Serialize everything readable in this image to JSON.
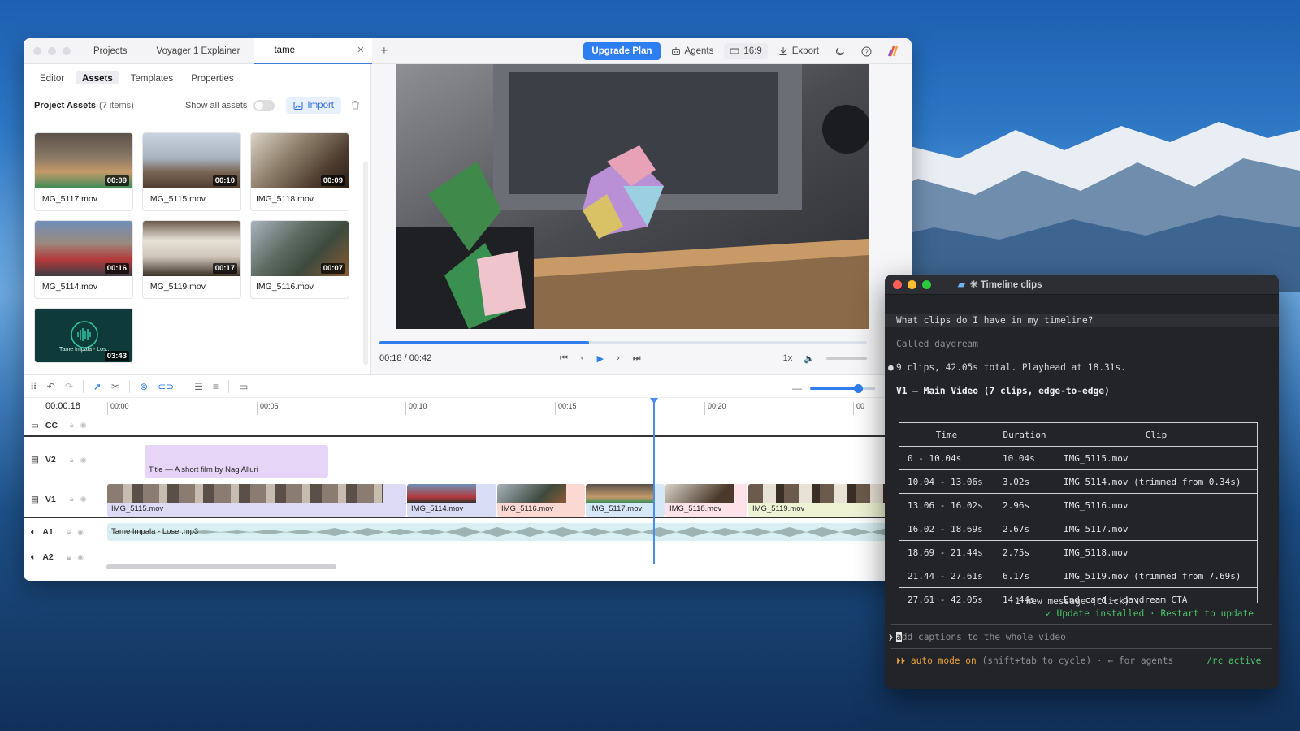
{
  "editor": {
    "tabs": [
      {
        "label": "Projects"
      },
      {
        "label": "Voyager 1 Explainer"
      },
      {
        "label": "tame",
        "active": true
      }
    ],
    "toolbar": {
      "upgrade_label": "Upgrade Plan",
      "agents_label": "Agents",
      "ratio_label": "16:9",
      "export_label": "Export"
    },
    "subtabs": [
      "Editor",
      "Assets",
      "Templates",
      "Properties"
    ],
    "assets": {
      "title": "Project Assets",
      "count": "(7 items)",
      "show_all_label": "Show all assets",
      "import_label": "Import",
      "items": [
        {
          "name": "IMG_5117.mov",
          "duration": "00:09"
        },
        {
          "name": "IMG_5115.mov",
          "duration": "00:10"
        },
        {
          "name": "IMG_5118.mov",
          "duration": "00:09"
        },
        {
          "name": "IMG_5114.mov",
          "duration": "00:16"
        },
        {
          "name": "IMG_5119.mov",
          "duration": "00:17"
        },
        {
          "name": "IMG_5116.mov",
          "duration": "00:07"
        }
      ],
      "audio_item": {
        "caption": "Tame Impala - Los...",
        "duration": "03:43"
      }
    },
    "player": {
      "time": "00:18 / 00:42",
      "progress": 0.43,
      "speed": "1x"
    },
    "timeline": {
      "timecode": "00:00:18",
      "ticks": [
        "00:00",
        "00:05",
        "00:10",
        "00:15",
        "00:20",
        "00"
      ],
      "tracks": [
        "CC",
        "V2",
        "V1",
        "A1",
        "A2"
      ],
      "title_clip": "Title — A short film by Nag Alluri",
      "v1_clips": [
        "IMG_5115.mov",
        "IMG_5114.mov",
        "IMG_5116.mov",
        "IMG_5117.mov",
        "IMG_5118.mov",
        "IMG_5119.mov"
      ],
      "audio_clip": "Tame Impala - Loser.mp3"
    }
  },
  "terminal": {
    "title": "✳ Timeline clips",
    "question": "What clips do I have in my timeline?",
    "called": "Called daydream",
    "summary": "9 clips, 42.05s total. Playhead at 18.31s.",
    "heading": "V1 — Main Video (7 clips, edge-to-edge)",
    "table_headers": [
      "Time",
      "Duration",
      "Clip"
    ],
    "table_rows": [
      [
        "0 - 10.04s",
        "10.04s",
        "IMG_5115.mov"
      ],
      [
        "10.04 - 13.06s",
        "3.02s",
        "IMG_5114.mov (trimmed from 0.34s)"
      ],
      [
        "13.06 - 16.02s",
        "2.96s",
        "IMG_5116.mov"
      ],
      [
        "16.02 - 18.69s",
        "2.67s",
        "IMG_5117.mov"
      ],
      [
        "18.69 - 21.44s",
        "2.75s",
        "IMG_5118.mov"
      ],
      [
        "21.44 - 27.61s",
        "6.17s",
        "IMG_5119.mov (trimmed from 7.69s)"
      ],
      [
        "27.61 - 42.05s",
        "14.44s",
        "End card — daydream CTA"
      ]
    ],
    "new_message": "1 new message (click) ↓",
    "update_note": "✓ Update installed · Restart to update",
    "input_cursor_char": "a",
    "input_text": "dd captions to the whole video",
    "status_left": "⏵⏵ auto mode on",
    "status_mid": "(shift+tab to cycle) · ← for agents",
    "status_right": "/rc active"
  }
}
